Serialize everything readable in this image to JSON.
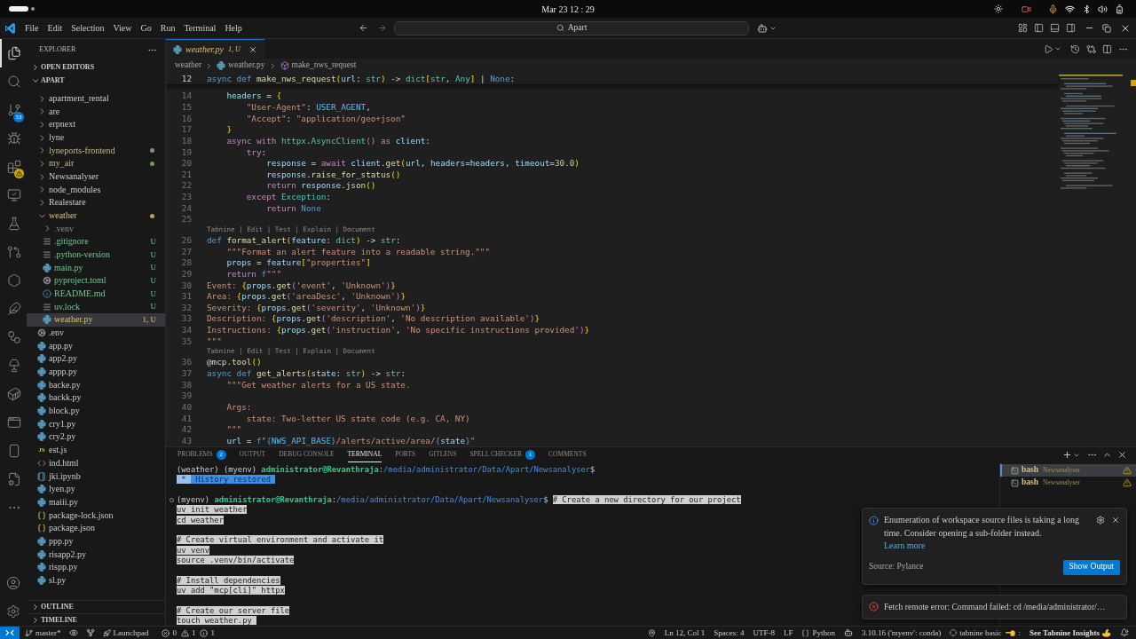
{
  "system_bar": {
    "clock": "Mar 23 12 : 29"
  },
  "title_bar": {
    "menus": [
      "File",
      "Edit",
      "Selection",
      "View",
      "Go",
      "Run",
      "Terminal",
      "Help"
    ],
    "search": {
      "label": "Apart"
    }
  },
  "activity_bar": {
    "items": [
      {
        "selected": true
      },
      {
        "selected": false
      },
      {
        "selected": false,
        "badge": "53"
      },
      {
        "selected": false
      },
      {
        "selected": false,
        "warning": true
      },
      {
        "selected": false
      },
      {
        "selected": false
      },
      {
        "selected": false
      },
      {
        "selected": false
      },
      {
        "selected": false
      },
      {
        "selected": false
      },
      {
        "selected": false
      },
      {
        "selected": false
      },
      {
        "selected": false
      },
      {
        "selected": false
      },
      {
        "selected": false
      },
      {
        "selected": false
      }
    ]
  },
  "sidebar": {
    "title": "EXPLORER",
    "open_editors": {
      "label": "OPEN EDITORS",
      "expanded": false
    },
    "root": {
      "label": "APART",
      "expanded": true
    },
    "tree": [
      {
        "label": "apartment_rental",
        "kind": "folder",
        "expanded": false,
        "selected": false
      },
      {
        "label": "are",
        "kind": "folder",
        "expanded": false,
        "selected": false
      },
      {
        "label": "erpnext",
        "kind": "folder",
        "expanded": false,
        "selected": false
      },
      {
        "label": "lyne",
        "kind": "folder",
        "expanded": false,
        "selected": false
      },
      {
        "label": "lyneports-frontend",
        "kind": "folder",
        "expanded": false,
        "selected": false,
        "git": {
          "kind": "modified"
        },
        "dot": {
          "color": "#8a8a8a"
        }
      },
      {
        "label": "my_air",
        "kind": "folder",
        "expanded": false,
        "selected": false,
        "git": {
          "kind": "modified"
        },
        "dot": {
          "color": "#6f9a5e"
        }
      },
      {
        "label": "Newsanalyser",
        "kind": "folder",
        "expanded": false,
        "selected": false
      },
      {
        "label": "node_modules",
        "kind": "folder",
        "expanded": false,
        "selected": false
      },
      {
        "label": "Realestare",
        "kind": "folder",
        "expanded": false,
        "selected": false
      },
      {
        "label": "weather",
        "kind": "folder",
        "expanded": true,
        "selected": false,
        "git": {
          "kind": "problem"
        },
        "dot": {
          "color": "#b9a44a"
        },
        "children": [
          {
            "label": ".venv",
            "kind": "folder",
            "expanded": false,
            "selected": false,
            "git": {
              "kind": "ignored"
            }
          },
          {
            "label": ".gitignore",
            "kind": "lines",
            "selected": false,
            "git": {
              "kind": "untracked"
            },
            "decoration": "U"
          },
          {
            "label": ".python-version",
            "kind": "lines",
            "selected": false,
            "git": {
              "kind": "untracked"
            },
            "decoration": "U"
          },
          {
            "label": "main.py",
            "kind": "python",
            "selected": false,
            "git": {
              "kind": "untracked"
            },
            "decoration": "U"
          },
          {
            "label": "pyproject.toml",
            "kind": "gear",
            "selected": false,
            "git": {
              "kind": "untracked"
            },
            "decoration": "U"
          },
          {
            "label": "README.md",
            "kind": "info",
            "selected": false,
            "git": {
              "kind": "untracked"
            },
            "decoration": "U"
          },
          {
            "label": "uv.lock",
            "kind": "lines",
            "selected": false,
            "git": {
              "kind": "untracked"
            },
            "decoration": "U"
          },
          {
            "label": "weather.py",
            "kind": "python",
            "selected": true,
            "git": {
              "kind": "problem"
            },
            "decoration": "1, U"
          }
        ]
      },
      {
        "label": ".env",
        "kind": "gear",
        "selected": false
      },
      {
        "label": "app.py",
        "kind": "python",
        "selected": false
      },
      {
        "label": "app2.py",
        "kind": "python",
        "selected": false
      },
      {
        "label": "appp.py",
        "kind": "python",
        "selected": false
      },
      {
        "label": "backe.py",
        "kind": "python",
        "selected": false
      },
      {
        "label": "backk.py",
        "kind": "python",
        "selected": false
      },
      {
        "label": "block.py",
        "kind": "python",
        "selected": false
      },
      {
        "label": "cry1.py",
        "kind": "python",
        "selected": false
      },
      {
        "label": "cry2.py",
        "kind": "python",
        "selected": false
      },
      {
        "label": "est.js",
        "kind": "js",
        "icon_label": "JS",
        "selected": false
      },
      {
        "label": "ind.html",
        "kind": "html",
        "selected": false
      },
      {
        "label": "jki.ipynb",
        "kind": "notebook",
        "selected": false
      },
      {
        "label": "lyen.py",
        "kind": "python",
        "selected": false
      },
      {
        "label": "maiii.py",
        "kind": "python",
        "selected": false
      },
      {
        "label": "package-lock.json",
        "kind": "json",
        "selected": false
      },
      {
        "label": "package.json",
        "kind": "json",
        "selected": false
      },
      {
        "label": "ppp.py",
        "kind": "python",
        "selected": false
      },
      {
        "label": "risapp2.py",
        "kind": "python",
        "selected": false
      },
      {
        "label": "rispp.py",
        "kind": "python",
        "selected": false
      },
      {
        "label": "sl.py",
        "kind": "python",
        "selected": false
      }
    ],
    "outline": {
      "label": "OUTLINE",
      "expanded": false
    },
    "timeline": {
      "label": "TIMELINE",
      "expanded": false
    }
  },
  "editor": {
    "tabs": [
      {
        "label": "weather.py",
        "status": "1, U",
        "selected": true,
        "problem": true
      }
    ],
    "breadcrumb": [
      {
        "label": "weather",
        "kind": "folder"
      },
      {
        "label": "weather.py",
        "kind": "python"
      },
      {
        "label": "make_nws_request",
        "kind": "method"
      }
    ],
    "sticky_line": {
      "number": "12",
      "current": true,
      "tokens": [
        {
          "text": "async def ",
          "kind": "keyword"
        },
        {
          "text": "make_nws_request",
          "kind": "function"
        },
        {
          "text": "(",
          "kind": "bracket"
        },
        {
          "text": "url",
          "kind": "variable"
        },
        {
          "text": ": ",
          "kind": "plain"
        },
        {
          "text": "str",
          "kind": "type"
        },
        {
          "text": ")",
          "kind": "bracket"
        },
        {
          "text": " -> ",
          "kind": "plain"
        },
        {
          "text": "dict",
          "kind": "type"
        },
        {
          "text": "[",
          "kind": "bracket"
        },
        {
          "text": "str",
          "kind": "type"
        },
        {
          "text": ", ",
          "kind": "plain"
        },
        {
          "text": "Any",
          "kind": "type"
        },
        {
          "text": "]",
          "kind": "bracket"
        },
        {
          "text": " | ",
          "kind": "plain"
        },
        {
          "text": "None",
          "kind": "keyword"
        },
        {
          "text": ":",
          "kind": "plain"
        }
      ]
    },
    "lines": [
      {
        "number": "14",
        "tokens": [
          {
            "text": "    headers",
            "kind": "variable"
          },
          {
            "text": " = ",
            "kind": "plain"
          },
          {
            "text": "{",
            "kind": "bracket"
          }
        ]
      },
      {
        "number": "15",
        "tokens": [
          {
            "text": "        \"User-Agent\"",
            "kind": "string"
          },
          {
            "text": ": ",
            "kind": "plain"
          },
          {
            "text": "USER_AGENT",
            "kind": "constant"
          },
          {
            "text": ",",
            "kind": "plain"
          }
        ]
      },
      {
        "number": "16",
        "tokens": [
          {
            "text": "        \"Accept\"",
            "kind": "string"
          },
          {
            "text": ": ",
            "kind": "plain"
          },
          {
            "text": "\"application/geo+json\"",
            "kind": "string"
          }
        ]
      },
      {
        "number": "17",
        "tokens": [
          {
            "text": "    }",
            "kind": "bracket"
          }
        ]
      },
      {
        "number": "18",
        "tokens": [
          {
            "text": "    async with ",
            "kind": "control"
          },
          {
            "text": "httpx",
            "kind": "type"
          },
          {
            "text": ".",
            "kind": "plain"
          },
          {
            "text": "AsyncClient",
            "kind": "type"
          },
          {
            "text": "()",
            "kind": "paren"
          },
          {
            "text": " as ",
            "kind": "control"
          },
          {
            "text": "client",
            "kind": "variable"
          },
          {
            "text": ":",
            "kind": "plain"
          }
        ]
      },
      {
        "number": "19",
        "tokens": [
          {
            "text": "        try",
            "kind": "control"
          },
          {
            "text": ":",
            "kind": "plain"
          }
        ]
      },
      {
        "number": "20",
        "tokens": [
          {
            "text": "            response",
            "kind": "variable"
          },
          {
            "text": " = ",
            "kind": "plain"
          },
          {
            "text": "await ",
            "kind": "control"
          },
          {
            "text": "client",
            "kind": "variable"
          },
          {
            "text": ".",
            "kind": "plain"
          },
          {
            "text": "get",
            "kind": "function"
          },
          {
            "text": "(",
            "kind": "bracket"
          },
          {
            "text": "url",
            "kind": "variable"
          },
          {
            "text": ", ",
            "kind": "plain"
          },
          {
            "text": "headers",
            "kind": "variable"
          },
          {
            "text": "=",
            "kind": "plain"
          },
          {
            "text": "headers",
            "kind": "variable"
          },
          {
            "text": ", ",
            "kind": "plain"
          },
          {
            "text": "timeout",
            "kind": "variable"
          },
          {
            "text": "=",
            "kind": "plain"
          },
          {
            "text": "30.0",
            "kind": "number"
          },
          {
            "text": ")",
            "kind": "bracket"
          }
        ]
      },
      {
        "number": "21",
        "tokens": [
          {
            "text": "            response",
            "kind": "variable"
          },
          {
            "text": ".",
            "kind": "plain"
          },
          {
            "text": "raise_for_status",
            "kind": "function"
          },
          {
            "text": "()",
            "kind": "bracket"
          }
        ]
      },
      {
        "number": "22",
        "tokens": [
          {
            "text": "            return ",
            "kind": "control"
          },
          {
            "text": "response",
            "kind": "variable"
          },
          {
            "text": ".",
            "kind": "plain"
          },
          {
            "text": "json",
            "kind": "function"
          },
          {
            "text": "()",
            "kind": "bracket"
          }
        ]
      },
      {
        "number": "23",
        "tokens": [
          {
            "text": "        except ",
            "kind": "control"
          },
          {
            "text": "Exception",
            "kind": "type"
          },
          {
            "text": ":",
            "kind": "plain"
          }
        ]
      },
      {
        "number": "24",
        "tokens": [
          {
            "text": "            return ",
            "kind": "control"
          },
          {
            "text": "None",
            "kind": "keyword"
          }
        ]
      },
      {
        "number": "25"
      },
      {
        "number": "26",
        "lens": "Tabnine | Edit | Test | Explain | Document",
        "tokens": [
          {
            "text": "def ",
            "kind": "keyword"
          },
          {
            "text": "format_alert",
            "kind": "function"
          },
          {
            "text": "(",
            "kind": "bracket"
          },
          {
            "text": "feature",
            "kind": "variable"
          },
          {
            "text": ": ",
            "kind": "plain"
          },
          {
            "text": "dict",
            "kind": "type"
          },
          {
            "text": ")",
            "kind": "bracket"
          },
          {
            "text": " -> ",
            "kind": "plain"
          },
          {
            "text": "str",
            "kind": "type"
          },
          {
            "text": ":",
            "kind": "plain"
          }
        ]
      },
      {
        "number": "27",
        "tokens": [
          {
            "text": "    \"\"\"Format an alert feature into a readable string.\"\"\"",
            "kind": "string"
          }
        ]
      },
      {
        "number": "28",
        "tokens": [
          {
            "text": "    props",
            "kind": "variable"
          },
          {
            "text": " = ",
            "kind": "plain"
          },
          {
            "text": "feature",
            "kind": "variable"
          },
          {
            "text": "[",
            "kind": "bracket"
          },
          {
            "text": "\"properties\"",
            "kind": "string"
          },
          {
            "text": "]",
            "kind": "bracket"
          }
        ]
      },
      {
        "number": "29",
        "tokens": [
          {
            "text": "    return ",
            "kind": "control"
          },
          {
            "text": "f",
            "kind": "keyword"
          },
          {
            "text": "\"\"\"",
            "kind": "string"
          }
        ]
      },
      {
        "number": "30",
        "tokens": [
          {
            "text": "Event: ",
            "kind": "string"
          },
          {
            "text": "{",
            "kind": "bracket"
          },
          {
            "text": "props",
            "kind": "variable"
          },
          {
            "text": ".",
            "kind": "plain"
          },
          {
            "text": "get",
            "kind": "function"
          },
          {
            "text": "(",
            "kind": "paren"
          },
          {
            "text": "'event'",
            "kind": "string"
          },
          {
            "text": ", ",
            "kind": "plain"
          },
          {
            "text": "'Unknown'",
            "kind": "string"
          },
          {
            "text": ")",
            "kind": "paren"
          },
          {
            "text": "}",
            "kind": "bracket"
          }
        ]
      },
      {
        "number": "31",
        "tokens": [
          {
            "text": "Area: ",
            "kind": "string"
          },
          {
            "text": "{",
            "kind": "bracket"
          },
          {
            "text": "props",
            "kind": "variable"
          },
          {
            "text": ".",
            "kind": "plain"
          },
          {
            "text": "get",
            "kind": "function"
          },
          {
            "text": "(",
            "kind": "paren"
          },
          {
            "text": "'areaDesc'",
            "kind": "string"
          },
          {
            "text": ", ",
            "kind": "plain"
          },
          {
            "text": "'Unknown'",
            "kind": "string"
          },
          {
            "text": ")",
            "kind": "paren"
          },
          {
            "text": "}",
            "kind": "bracket"
          }
        ]
      },
      {
        "number": "32",
        "tokens": [
          {
            "text": "Severity: ",
            "kind": "string"
          },
          {
            "text": "{",
            "kind": "bracket"
          },
          {
            "text": "props",
            "kind": "variable"
          },
          {
            "text": ".",
            "kind": "plain"
          },
          {
            "text": "get",
            "kind": "function"
          },
          {
            "text": "(",
            "kind": "paren"
          },
          {
            "text": "'severity'",
            "kind": "string"
          },
          {
            "text": ", ",
            "kind": "plain"
          },
          {
            "text": "'Unknown'",
            "kind": "string"
          },
          {
            "text": ")",
            "kind": "paren"
          },
          {
            "text": "}",
            "kind": "bracket"
          }
        ]
      },
      {
        "number": "33",
        "tokens": [
          {
            "text": "Description: ",
            "kind": "string"
          },
          {
            "text": "{",
            "kind": "bracket"
          },
          {
            "text": "props",
            "kind": "variable"
          },
          {
            "text": ".",
            "kind": "plain"
          },
          {
            "text": "get",
            "kind": "function"
          },
          {
            "text": "(",
            "kind": "paren"
          },
          {
            "text": "'description'",
            "kind": "string"
          },
          {
            "text": ", ",
            "kind": "plain"
          },
          {
            "text": "'No description available'",
            "kind": "string"
          },
          {
            "text": ")",
            "kind": "paren"
          },
          {
            "text": "}",
            "kind": "bracket"
          }
        ]
      },
      {
        "number": "34",
        "tokens": [
          {
            "text": "Instructions: ",
            "kind": "string"
          },
          {
            "text": "{",
            "kind": "bracket"
          },
          {
            "text": "props",
            "kind": "variable"
          },
          {
            "text": ".",
            "kind": "plain"
          },
          {
            "text": "get",
            "kind": "function"
          },
          {
            "text": "(",
            "kind": "paren"
          },
          {
            "text": "'instruction'",
            "kind": "string"
          },
          {
            "text": ", ",
            "kind": "plain"
          },
          {
            "text": "'No specific instructions provided'",
            "kind": "string"
          },
          {
            "text": ")",
            "kind": "paren"
          },
          {
            "text": "}",
            "kind": "bracket"
          }
        ]
      },
      {
        "number": "35",
        "tokens": [
          {
            "text": "\"\"\"",
            "kind": "string"
          }
        ]
      },
      {
        "number": "36",
        "lens": "Tabnine | Edit | Test | Explain | Document",
        "tokens": [
          {
            "text": "@mcp",
            "kind": "plain"
          },
          {
            "text": ".",
            "kind": "plain"
          },
          {
            "text": "tool",
            "kind": "function"
          },
          {
            "text": "()",
            "kind": "bracket"
          }
        ]
      },
      {
        "number": "37",
        "tokens": [
          {
            "text": "async def ",
            "kind": "keyword"
          },
          {
            "text": "get_alerts",
            "kind": "function"
          },
          {
            "text": "(",
            "kind": "bracket"
          },
          {
            "text": "state",
            "kind": "variable"
          },
          {
            "text": ": ",
            "kind": "plain"
          },
          {
            "text": "str",
            "kind": "type"
          },
          {
            "text": ")",
            "kind": "bracket"
          },
          {
            "text": " -> ",
            "kind": "plain"
          },
          {
            "text": "str",
            "kind": "type"
          },
          {
            "text": ":",
            "kind": "plain"
          }
        ]
      },
      {
        "number": "38",
        "tokens": [
          {
            "text": "    \"\"\"Get weather alerts for a US state.",
            "kind": "string"
          }
        ]
      },
      {
        "number": "39"
      },
      {
        "number": "40",
        "tokens": [
          {
            "text": "    Args:",
            "kind": "string"
          }
        ]
      },
      {
        "number": "41",
        "tokens": [
          {
            "text": "        state: Two-letter US state code (e.g. CA, NY)",
            "kind": "string"
          }
        ]
      },
      {
        "number": "42",
        "tokens": [
          {
            "text": "    \"\"\"",
            "kind": "string"
          }
        ]
      },
      {
        "number": "43",
        "tokens": [
          {
            "text": "    url",
            "kind": "variable"
          },
          {
            "text": " = ",
            "kind": "plain"
          },
          {
            "text": "f",
            "kind": "keyword"
          },
          {
            "text": "\"",
            "kind": "string"
          },
          {
            "text": "{",
            "kind": "keyword"
          },
          {
            "text": "NWS_API_BASE",
            "kind": "constant"
          },
          {
            "text": "}",
            "kind": "keyword"
          },
          {
            "text": "/alerts/active/area/",
            "kind": "string"
          },
          {
            "text": "{",
            "kind": "keyword"
          },
          {
            "text": "state",
            "kind": "variable"
          },
          {
            "text": "}",
            "kind": "keyword"
          },
          {
            "text": "\"",
            "kind": "string"
          }
        ]
      }
    ]
  },
  "panel": {
    "tabs": [
      {
        "label": "PROBLEMS",
        "badge": "2",
        "selected": false
      },
      {
        "label": "OUTPUT",
        "selected": false
      },
      {
        "label": "DEBUG CONSOLE",
        "selected": false
      },
      {
        "label": "TERMINAL",
        "selected": true
      },
      {
        "label": "PORTS",
        "selected": false
      },
      {
        "label": "GITLENS",
        "selected": false
      },
      {
        "label": "SPELL CHECKER",
        "badge": "1",
        "selected": false
      },
      {
        "label": "COMMENTS",
        "selected": false
      }
    ],
    "terminal": {
      "blocks": [
        [
          {
            "segments": [
              {
                "text": "(weather) (myenv) ",
                "kind": "plain"
              },
              {
                "text": "administrator@Revanthraja",
                "kind": "user"
              },
              {
                "text": ":",
                "kind": "plain"
              },
              {
                "text": "/media/administrator/Data/Apart/Newsanalyser",
                "kind": "path"
              },
              {
                "text": "$",
                "kind": "plain"
              }
            ]
          },
          {
            "segments": [
              {
                "text": " * ",
                "kind": "star"
              },
              {
                "text": " History restored ",
                "kind": "banner"
              }
            ]
          }
        ],
        [
          {
            "mark": true,
            "segments": [
              {
                "text": "(myenv) ",
                "kind": "plain"
              },
              {
                "text": "administrator@Revanthraja",
                "kind": "user"
              },
              {
                "text": ":",
                "kind": "plain"
              },
              {
                "text": "/media/administrator/Data/Apart/Newsanalyser",
                "kind": "path"
              },
              {
                "text": "$ ",
                "kind": "plain"
              },
              {
                "text": "# Create a new directory for our project",
                "kind": "selection"
              }
            ]
          },
          {
            "segments": [
              {
                "text": "uv init weather",
                "kind": "selection"
              }
            ]
          },
          {
            "segments": [
              {
                "text": "cd weather",
                "kind": "selection"
              }
            ]
          }
        ],
        [
          {
            "segments": [
              {
                "text": "# Create virtual environment and activate it",
                "kind": "selection"
              }
            ]
          },
          {
            "segments": [
              {
                "text": "uv venv",
                "kind": "selection"
              }
            ]
          },
          {
            "segments": [
              {
                "text": "source .venv/bin/activate",
                "kind": "selection"
              }
            ]
          }
        ],
        [
          {
            "segments": [
              {
                "text": "# Install dependencies",
                "kind": "selection"
              }
            ]
          },
          {
            "segments": [
              {
                "text": "uv add \"mcp[cli]\" httpx",
                "kind": "selection"
              }
            ]
          }
        ],
        [
          {
            "segments": [
              {
                "text": "# Create our server file",
                "kind": "selection"
              }
            ]
          },
          {
            "segments": [
              {
                "text": "touch weather.py ",
                "kind": "selection"
              }
            ]
          }
        ]
      ]
    },
    "terminals": [
      {
        "label": "bash",
        "detail": "Newsanalyser",
        "selected": true,
        "warning": true
      },
      {
        "label": "bash",
        "detail": "Newsanalyser",
        "selected": false,
        "warning": true
      }
    ]
  },
  "notifications": [
    {
      "kind": "info",
      "message": "Enumeration of workspace source files is taking a long time. Consider opening a sub-folder instead.",
      "link": "Learn more",
      "closable": true,
      "source": "Source: Pylance",
      "action": "Show Output"
    },
    {
      "kind": "error",
      "message": "Fetch remote error: Command failed: cd /media/administrator/…",
      "closable": false
    }
  ],
  "status_bar": {
    "branch": "master*",
    "launchpad": "Launchpad",
    "problems": {
      "errors": "0",
      "warnings": "1",
      "infos": "1"
    },
    "position": "Ln 12, Col 1",
    "indent": "Spaces: 4",
    "encoding": "UTF-8",
    "eol": "LF",
    "language": "Python",
    "interpreter": "3.10.16 ('myenv': conda)",
    "tabnine": "tabnine basic",
    "tabnine_tail": ":",
    "insights": "See Tabnine Insights"
  }
}
